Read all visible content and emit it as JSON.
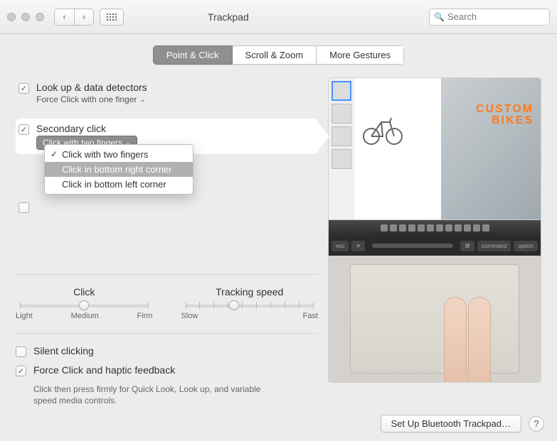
{
  "window": {
    "title": "Trackpad",
    "search_placeholder": "Search"
  },
  "tabs": [
    {
      "label": "Point & Click",
      "active": true
    },
    {
      "label": "Scroll & Zoom",
      "active": false
    },
    {
      "label": "More Gestures",
      "active": false
    }
  ],
  "options": {
    "lookup": {
      "title": "Look up & data detectors",
      "sub": "Force Click with one finger",
      "checked": true
    },
    "secondary": {
      "title": "Secondary click",
      "sub": "Click with two fingers",
      "checked": true,
      "menu": [
        {
          "label": "Click with two fingers",
          "checked": true,
          "highlight": false
        },
        {
          "label": "Click in bottom right corner",
          "checked": false,
          "highlight": true
        },
        {
          "label": "Click in bottom left corner",
          "checked": false,
          "highlight": false
        }
      ]
    },
    "tap": {
      "checked": false
    }
  },
  "sliders": {
    "click": {
      "title": "Click",
      "labels": [
        "Light",
        "Medium",
        "Firm"
      ],
      "value_pct": 50
    },
    "tracking": {
      "title": "Tracking speed",
      "labels": [
        "Slow",
        "Fast"
      ],
      "value_pct": 38
    }
  },
  "bottom": {
    "silent": {
      "label": "Silent clicking",
      "checked": false
    },
    "force": {
      "label": "Force Click and haptic feedback",
      "checked": true,
      "desc": "Click then press firmly for Quick Look, Look up, and variable speed media controls."
    }
  },
  "preview": {
    "headline1": "CUSTOM",
    "headline2": "BIKES",
    "touchbar": {
      "left": [
        "esc",
        "✕"
      ],
      "right": [
        "⌘",
        "command",
        "option"
      ]
    }
  },
  "footer": {
    "bluetooth": "Set Up Bluetooth Trackpad…",
    "help": "?"
  }
}
